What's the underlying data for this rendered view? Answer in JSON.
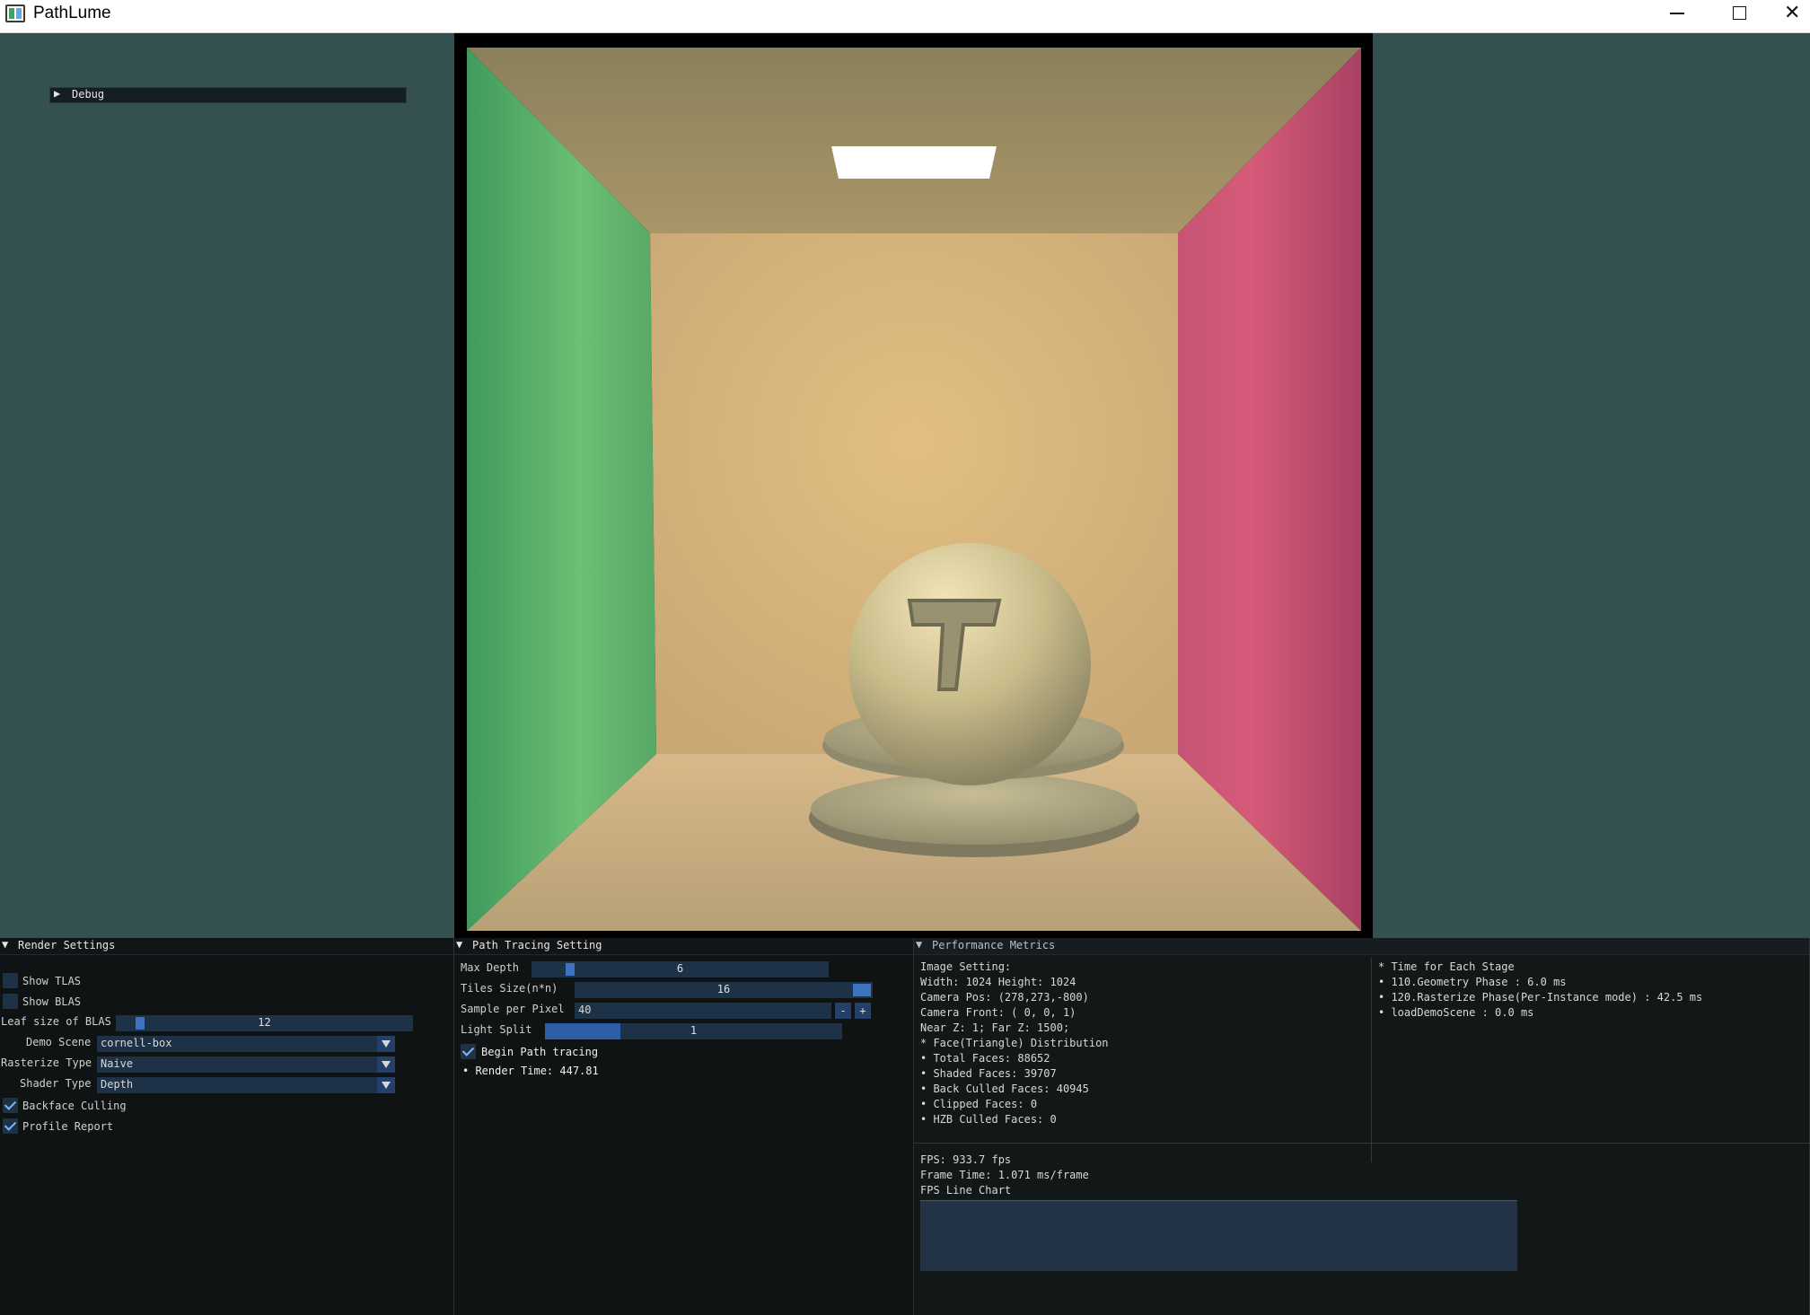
{
  "window": {
    "title": "PathLume",
    "minimize_glyph": "",
    "close_glyph": "✕"
  },
  "debug": {
    "label": "Debug",
    "arrow": "▶"
  },
  "render_settings": {
    "title": "Render Settings",
    "arrow": "▼",
    "show_tlas": {
      "label": "Show TLAS",
      "checked": false
    },
    "show_blas": {
      "label": "Show BLAS",
      "checked": false
    },
    "leaf_size": {
      "label": "Leaf size of BLAS",
      "value": "12"
    },
    "demo_scene": {
      "label": "Demo Scene",
      "value": "cornell-box"
    },
    "rasterize_type": {
      "label": "Rasterize Type",
      "value": "Naive"
    },
    "shader_type": {
      "label": "Shader Type",
      "value": "Depth"
    },
    "backface_culling": {
      "label": "Backface Culling",
      "checked": true
    },
    "profile_report": {
      "label": "Profile Report",
      "checked": true
    }
  },
  "path_tracing": {
    "title": "Path Tracing Setting",
    "arrow": "▼",
    "max_depth": {
      "label": "Max Depth",
      "value": "6"
    },
    "tiles_size": {
      "label": "Tiles Size(n*n)",
      "value": "16"
    },
    "sample_per_pixel": {
      "label": "Sample per Pixel",
      "value": "40",
      "minus": "-",
      "plus": "+"
    },
    "light_split": {
      "label": "Light Split",
      "value": "1"
    },
    "begin": {
      "label": "Begin Path tracing",
      "checked": true
    },
    "render_time": "• Render Time: 447.81"
  },
  "performance": {
    "title": "Performance Metrics",
    "arrow": "▼",
    "image_setting": [
      "Image Setting:",
      "Width: 1024 Height: 1024",
      "Camera Pos: (278,273,-800)",
      "Camera Front: ( 0, 0, 1)",
      "Near Z:  1; Far Z: 1500;",
      "* Face(Triangle) Distribution",
      "• Total Faces: 88652",
      "• Shaded Faces: 39707",
      "• Back Culled Faces: 40945",
      "• Clipped Faces: 0",
      "• HZB Culled Faces: 0"
    ],
    "stages": [
      "* Time for Each Stage",
      "• 110.Geometry Phase : 6.0 ms",
      "• 120.Rasterize Phase(Per-Instance mode) : 42.5 ms",
      "• loadDemoScene : 0.0 ms"
    ],
    "fps": "FPS: 933.7 fps",
    "frame_time": "Frame Time: 1.071 ms/frame",
    "chart_label": "FPS Line Chart"
  }
}
